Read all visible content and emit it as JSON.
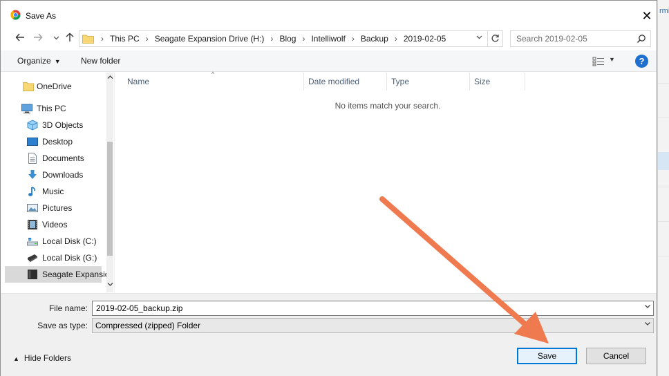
{
  "window": {
    "title": "Save As",
    "close_glyph": "✕"
  },
  "navigation": {
    "back_icon": "arrow-left-icon",
    "forward_icon": "arrow-right-icon",
    "recent_icon": "chevron-down-icon",
    "up_icon": "arrow-up-icon"
  },
  "address": {
    "breadcrumbs": [
      "This PC",
      "Seagate Expansion Drive (H:)",
      "Blog",
      "Intelliwolf",
      "Backup",
      "2019-02-05"
    ],
    "separator": "›"
  },
  "search": {
    "placeholder": "Search 2019-02-05"
  },
  "toolbar": {
    "organize_label": "Organize",
    "new_folder_label": "New folder"
  },
  "sidebar": {
    "items": [
      {
        "label": "OneDrive",
        "icon": "folder-icon"
      },
      {
        "label": "This PC",
        "icon": "computer-icon"
      },
      {
        "label": "3D Objects",
        "icon": "cube-icon"
      },
      {
        "label": "Desktop",
        "icon": "desktop-icon"
      },
      {
        "label": "Documents",
        "icon": "document-icon"
      },
      {
        "label": "Downloads",
        "icon": "download-icon"
      },
      {
        "label": "Music",
        "icon": "music-icon"
      },
      {
        "label": "Pictures",
        "icon": "picture-icon"
      },
      {
        "label": "Videos",
        "icon": "film-icon"
      },
      {
        "label": "Local Disk (C:)",
        "icon": "drive-icon"
      },
      {
        "label": "Local Disk (G:)",
        "icon": "drive-icon"
      },
      {
        "label": "Seagate Expansio",
        "icon": "external-drive-icon"
      }
    ]
  },
  "filelist": {
    "columns": [
      "Name",
      "Date modified",
      "Type",
      "Size"
    ],
    "empty_message": "No items match your search."
  },
  "form": {
    "filename_label": "File name:",
    "filename_value": "2019-02-05_backup.zip",
    "filetype_label": "Save as type:",
    "filetype_value": "Compressed (zipped) Folder"
  },
  "footer": {
    "hide_folders_label": "Hide Folders",
    "save_label": "Save",
    "cancel_label": "Cancel"
  },
  "background": {
    "peek_text": "rmi"
  },
  "colors": {
    "accent": "#0078d7",
    "annotation_arrow": "#f07a50"
  }
}
